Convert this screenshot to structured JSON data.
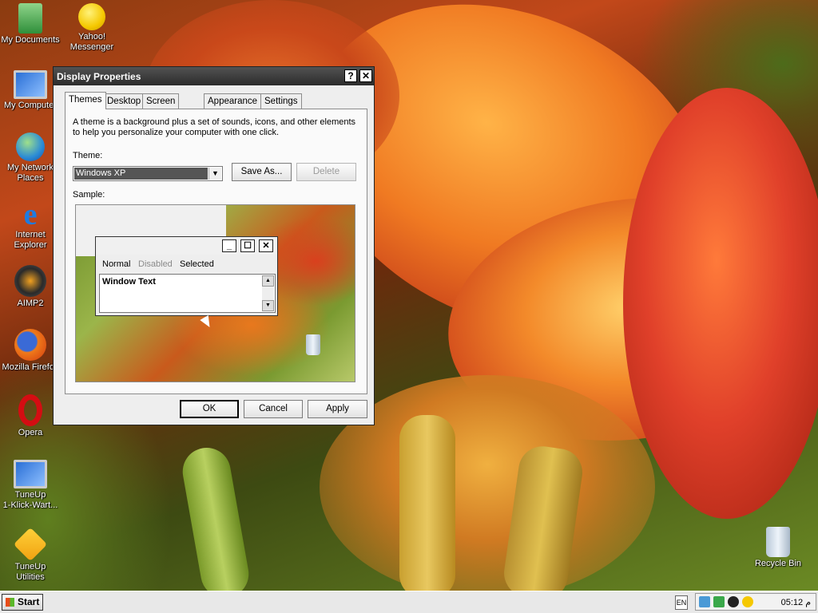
{
  "desktop": {
    "icons": [
      {
        "label": "My Documents"
      },
      {
        "label": "Yahoo!\nMessenger"
      },
      {
        "label": "My Computer"
      },
      {
        "label": "My Network\nPlaces"
      },
      {
        "label": "Internet\nExplorer"
      },
      {
        "label": "AIMP2"
      },
      {
        "label": "Mozilla Firefox"
      },
      {
        "label": "Opera"
      },
      {
        "label": "TuneUp\n1-Klick-Wart..."
      },
      {
        "label": "TuneUp Utilities"
      },
      {
        "label": "Recycle Bin"
      }
    ]
  },
  "dialog": {
    "title": "Display Properties",
    "help_label": "?",
    "close_label": "✕",
    "tabs": [
      {
        "label": "Themes",
        "active": true
      },
      {
        "label": "Desktop"
      },
      {
        "label": "Screen Saver"
      },
      {
        "label": "Appearance"
      },
      {
        "label": "Settings"
      }
    ],
    "description_line1": "A theme is a background plus a set of sounds, icons, and other elements",
    "description_line2": "to help you personalize your computer with one click.",
    "theme_label": "Theme:",
    "theme_value": "Windows XP",
    "save_as_label": "Save As...",
    "delete_label": "Delete",
    "sample_label": "Sample:",
    "sample": {
      "normal": "Normal",
      "disabled": "Disabled",
      "selected": "Selected",
      "window_text": "Window Text"
    },
    "ok_label": "OK",
    "cancel_label": "Cancel",
    "apply_label": "Apply"
  },
  "taskbar": {
    "start_label": "Start",
    "language": "EN",
    "clock": "05:12 م"
  },
  "colors": {
    "titlebar": "#3a3a3a",
    "dialog_bg": "#eeeeee",
    "selection": "#555555"
  }
}
